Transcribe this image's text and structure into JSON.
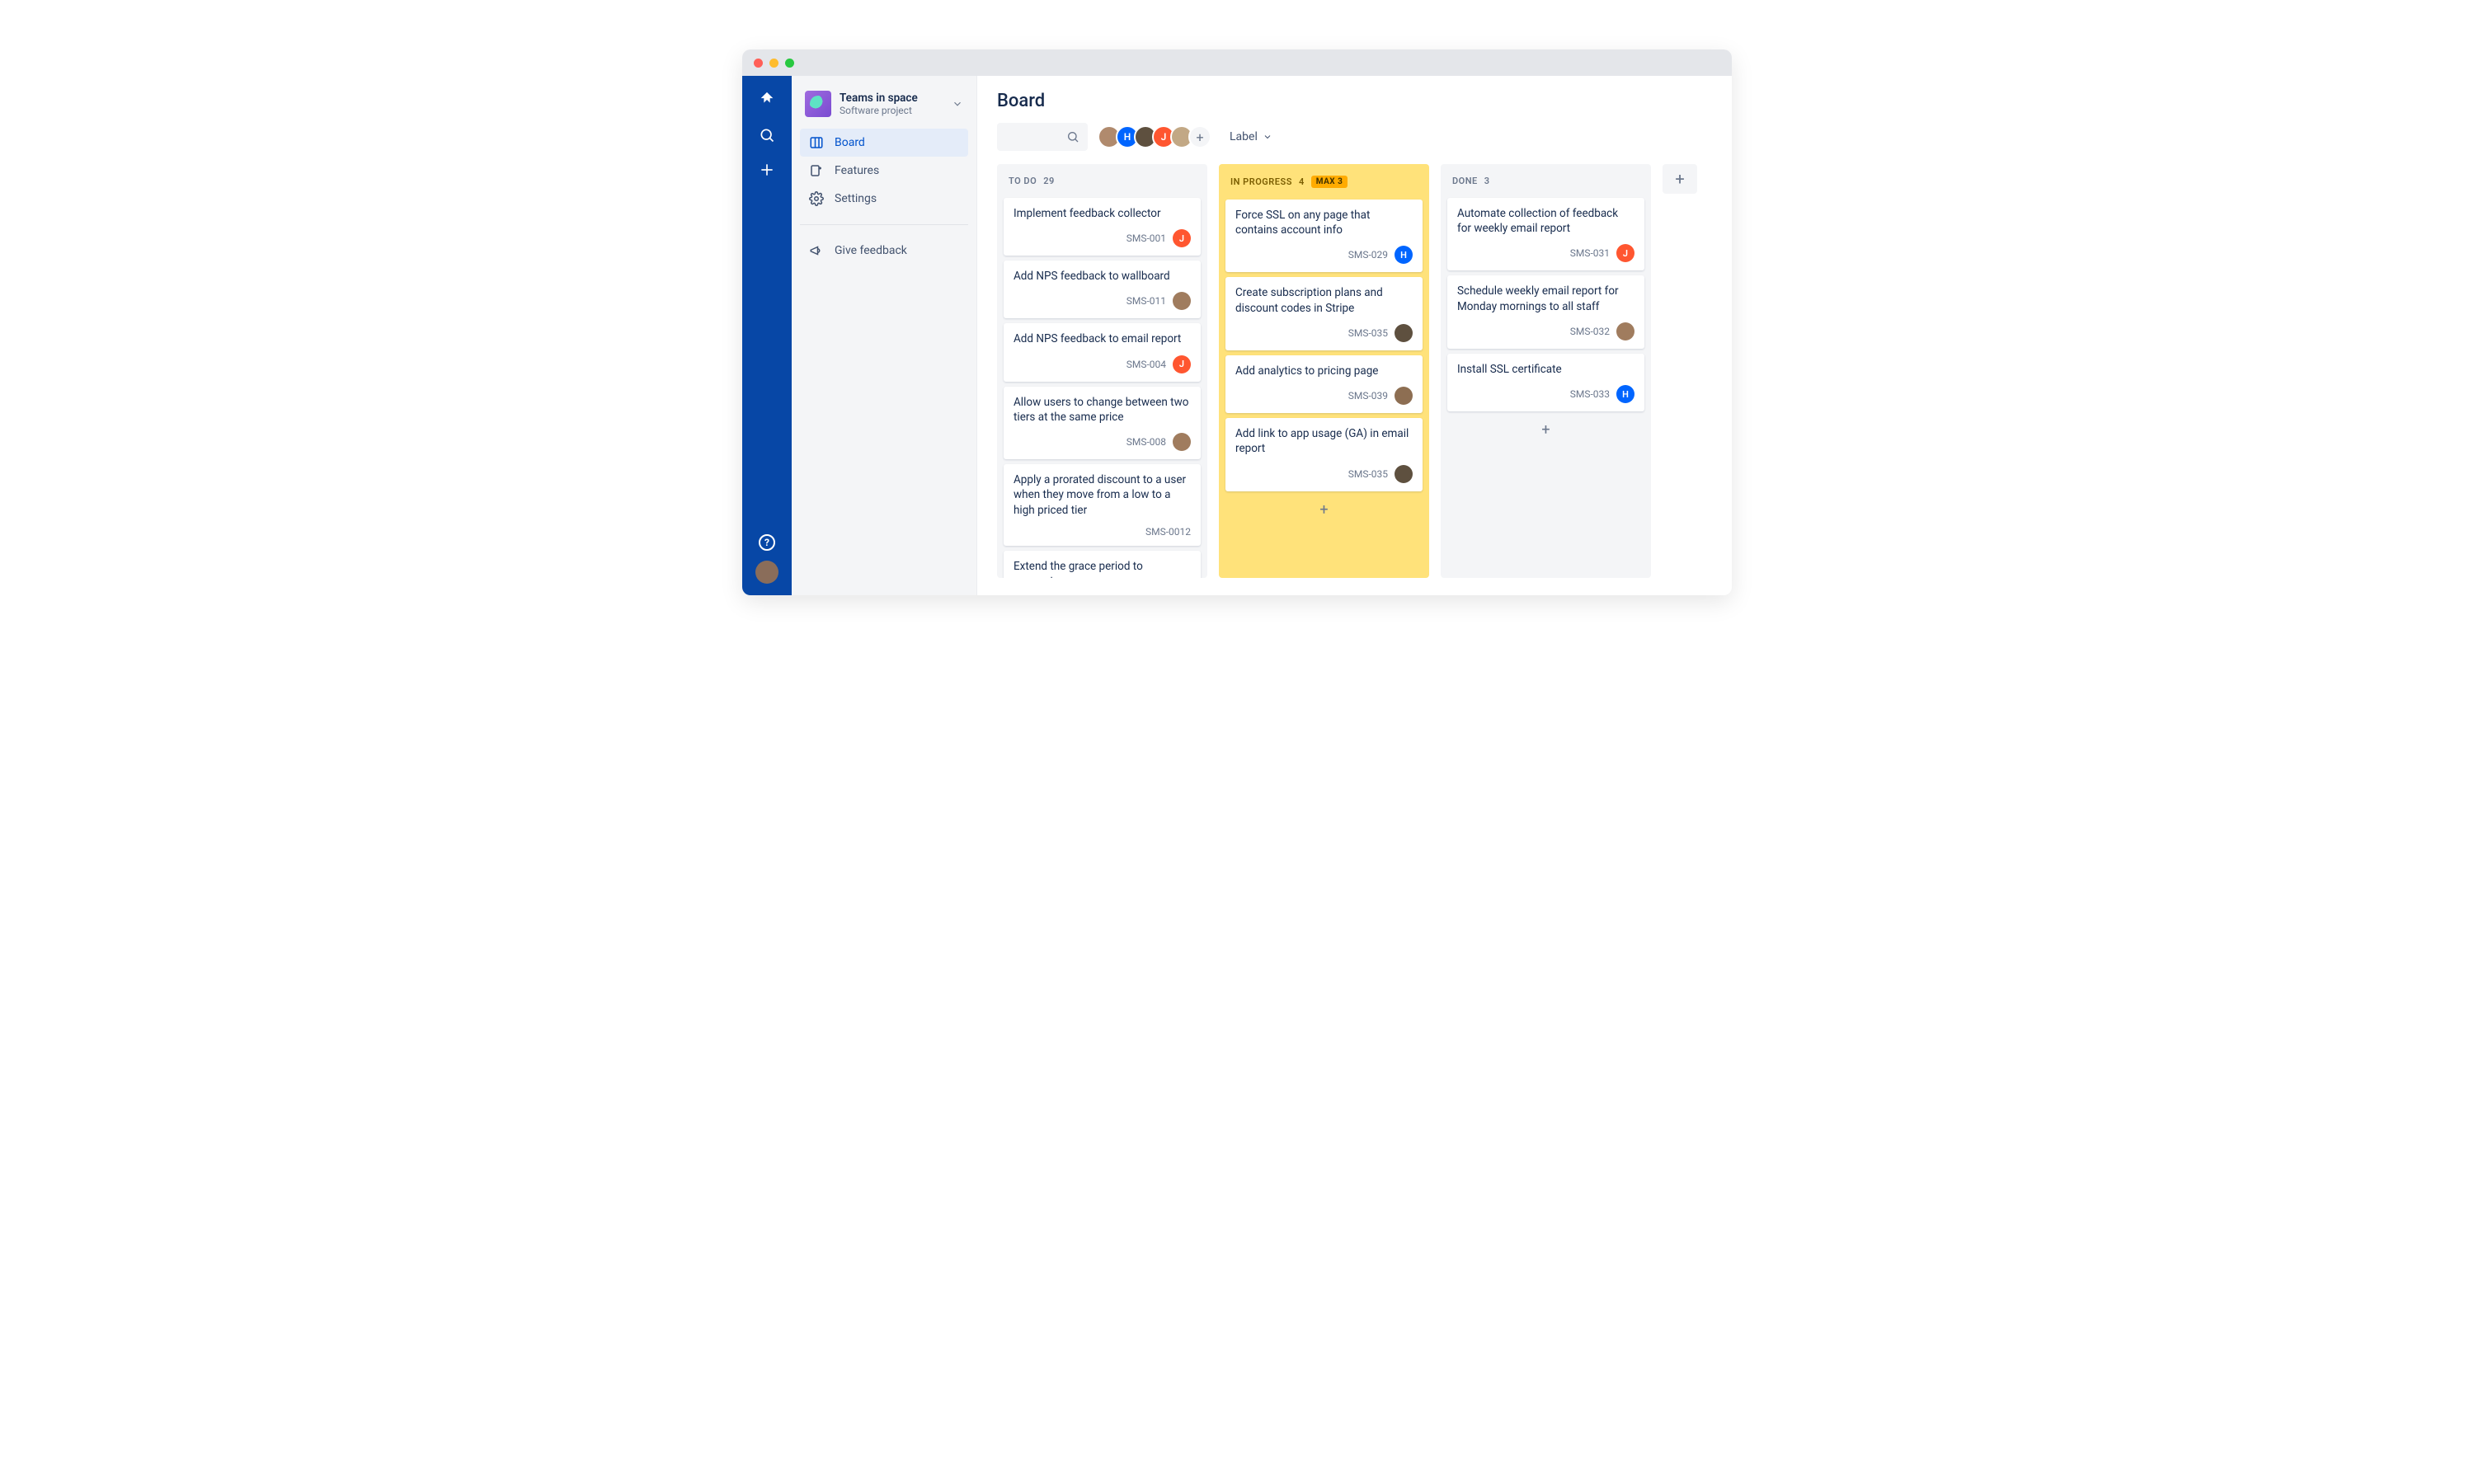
{
  "project": {
    "name": "Teams in space",
    "subtitle": "Software project"
  },
  "sidebar": {
    "items": [
      {
        "label": "Board"
      },
      {
        "label": "Features"
      },
      {
        "label": "Settings"
      }
    ],
    "feedback": "Give feedback"
  },
  "page": {
    "title": "Board"
  },
  "toolbar": {
    "label_filter": "Label",
    "avatars": [
      {
        "initial": "",
        "cls": "c1"
      },
      {
        "initial": "H",
        "cls": "c2"
      },
      {
        "initial": "",
        "cls": "c3"
      },
      {
        "initial": "J",
        "cls": "c4"
      },
      {
        "initial": "",
        "cls": "c5"
      }
    ]
  },
  "columns": [
    {
      "name": "TO DO",
      "count": "29",
      "wip": false,
      "cards": [
        {
          "title": "Implement feedback collector",
          "key": "SMS-001",
          "assignee": "orange",
          "initial": "J"
        },
        {
          "title": "Add NPS feedback to wallboard",
          "key": "SMS-011",
          "assignee": "photo1",
          "initial": ""
        },
        {
          "title": "Add NPS feedback to email report",
          "key": "SMS-004",
          "assignee": "orange",
          "initial": "J"
        },
        {
          "title": "Allow users to change between two tiers at the same price",
          "key": "SMS-008",
          "assignee": "photo1",
          "initial": ""
        },
        {
          "title": "Apply a prorated discount to a user when they move from a low to a high priced tier",
          "key": "SMS-0012",
          "assignee": "",
          "initial": ""
        },
        {
          "title": "Extend the grace period to accounts",
          "key": "",
          "assignee": "",
          "initial": ""
        }
      ]
    },
    {
      "name": "IN PROGRESS",
      "count": "4",
      "wip": true,
      "max": "MAX 3",
      "cards": [
        {
          "title": "Force SSL on any page that contains account info",
          "key": "SMS-029",
          "assignee": "blue",
          "initial": "H"
        },
        {
          "title": "Create subscription plans and discount codes in Stripe",
          "key": "SMS-035",
          "assignee": "photo3",
          "initial": ""
        },
        {
          "title": "Add analytics to pricing page",
          "key": "SMS-039",
          "assignee": "photo2",
          "initial": ""
        },
        {
          "title": "Add link to app usage (GA) in email report",
          "key": "SMS-035",
          "assignee": "photo3",
          "initial": ""
        }
      ]
    },
    {
      "name": "DONE",
      "count": "3",
      "wip": false,
      "cards": [
        {
          "title": "Automate collection of feedback for weekly email report",
          "key": "SMS-031",
          "assignee": "orange",
          "initial": "J"
        },
        {
          "title": "Schedule weekly email report for Monday mornings to all staff",
          "key": "SMS-032",
          "assignee": "photo1",
          "initial": ""
        },
        {
          "title": "Install SSL certificate",
          "key": "SMS-033",
          "assignee": "blue",
          "initial": "H"
        }
      ]
    }
  ]
}
